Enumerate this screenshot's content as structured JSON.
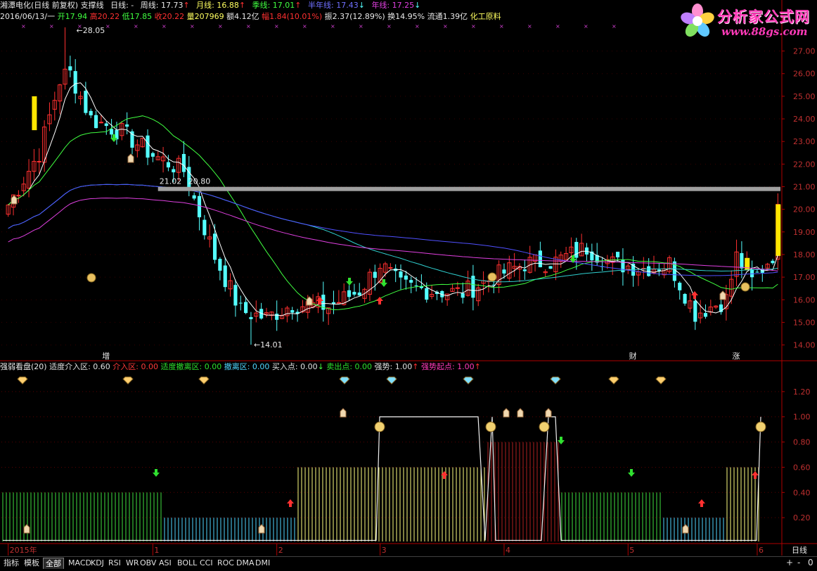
{
  "header": {
    "title": "湘潭电化(日线 前复权) 支撑线",
    "daily_label": "日线: -",
    "week_label": "周线: 17.73",
    "month_label": "月线: 16.88",
    "quarter_label": "季线: 17.01",
    "half_year_label": "半年线: 17.43",
    "year_label": "年线: 17.25",
    "arrows": {
      "week": "↑",
      "month": "↑",
      "quarter": "↑",
      "half": "↓",
      "year": "↓"
    }
  },
  "quote": {
    "date": "2016/06/13/一",
    "open": "开17.94",
    "high": "高20.22",
    "low": "低17.85",
    "close": "收20.22",
    "volume": "量207969",
    "amount": "额4.12亿",
    "change": "幅1.84(10.01%)",
    "amplitude": "振2.37(12.89%)",
    "turnover": "换14.95%",
    "float_cap": "流通1.39亿",
    "sector": "化工原料"
  },
  "logo": {
    "name": "分析家公式网",
    "url_text": "www.88gs.com"
  },
  "price_axis": {
    "ticks": [
      "27.00",
      "26.00",
      "25.00",
      "24.00",
      "23.00",
      "22.00",
      "21.00",
      "20.00",
      "19.00",
      "18.00",
      "17.00",
      "16.00",
      "15.00",
      "14.00"
    ],
    "tick_values": [
      27,
      26,
      25,
      24,
      23,
      22,
      21,
      20,
      19,
      18,
      17,
      16,
      15,
      14
    ],
    "range": [
      13.8,
      28.2
    ]
  },
  "annotations": {
    "high": "28.05",
    "low": "14.01",
    "support_left": "21.02",
    "support_right": "20.80",
    "support_level": 20.9,
    "markers": [
      "增",
      "财",
      "涨"
    ]
  },
  "indicator": {
    "title": "强弱看盘(20)",
    "items": [
      {
        "label": "适度介入区: 0.60",
        "color": "#e0e0e0"
      },
      {
        "label": "介入区: 0.00",
        "color": "#ff3a3a"
      },
      {
        "label": "适度撤离区: 0.00",
        "color": "#2de02d"
      },
      {
        "label": "撤离区: 0.00",
        "color": "#4fd6ff"
      },
      {
        "label": "买入点: 0.00",
        "color": "#e0e0e0",
        "arrow": "↓"
      },
      {
        "label": "卖出点: 0.00",
        "color": "#2de02d"
      },
      {
        "label": "强势: 1.00",
        "color": "#e0e0e0",
        "arrow": "↑"
      },
      {
        "label": "强势起点: 1.00",
        "color": "#ff3ab8",
        "arrow": "↑"
      }
    ],
    "axis_ticks": [
      "1.20",
      "1.00",
      "0.80",
      "0.60",
      "0.40",
      "0.20"
    ],
    "axis_values": [
      1.2,
      1.0,
      0.8,
      0.6,
      0.4,
      0.2
    ],
    "range": [
      0,
      1.35
    ]
  },
  "time_axis": {
    "labels": [
      "2015年",
      "1",
      "2",
      "3",
      "4",
      "5",
      "6"
    ],
    "positions": [
      0,
      28,
      52,
      72,
      96,
      120,
      145
    ],
    "period": "日线"
  },
  "tabs": [
    "指标",
    "模板",
    "全部",
    "MACD",
    "KDJ",
    "RSI",
    "WR",
    "OBV",
    "ASI",
    "BOLL",
    "CCI",
    "ROC",
    "DMA",
    "DMI"
  ],
  "active_tab": "全部",
  "controls": {
    "plus": "+",
    "minus": "-",
    "zero": "0"
  },
  "colors": {
    "up": "#ff3030",
    "down": "#54ffff",
    "ma5": "#ffffff",
    "ma10": "#ffff60",
    "ma20": "#40ff40",
    "ma60": "#30d0d0",
    "ma120": "#5050ff",
    "ma250": "#e040e0",
    "support": "#a0a0a0",
    "axis": "#b00000"
  },
  "icons": [
    "coin-bag-icon",
    "hand-icon",
    "gem-icon",
    "smiley-icon",
    "up-arrow-icon",
    "down-arrow-icon"
  ]
}
